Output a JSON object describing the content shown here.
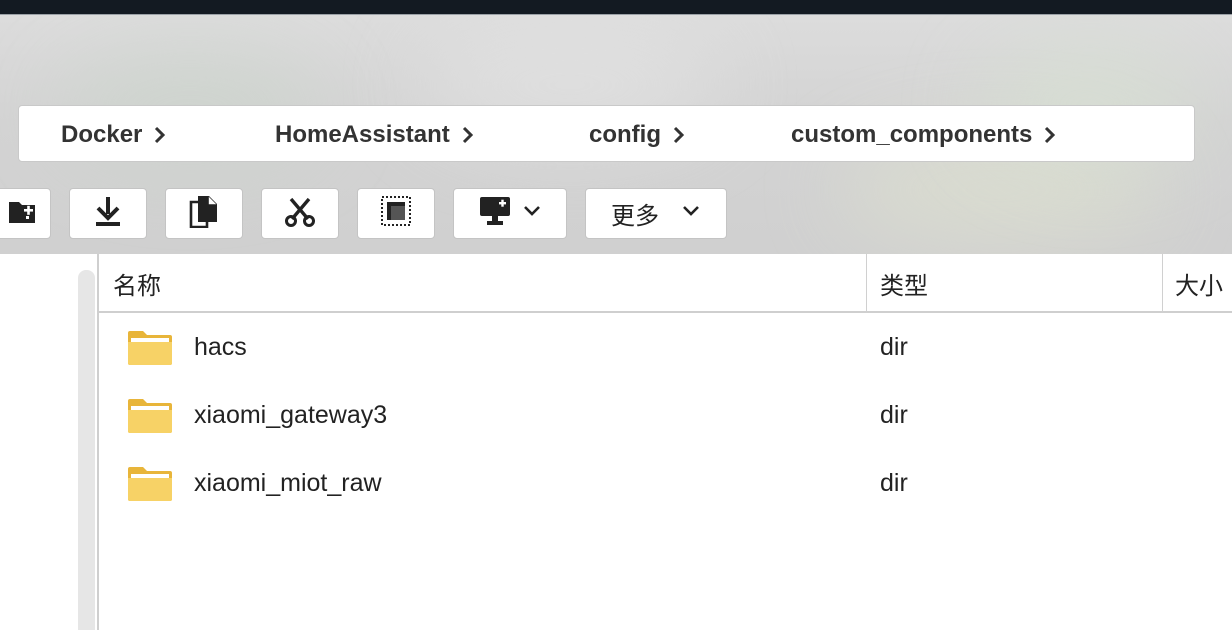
{
  "breadcrumb": {
    "items": [
      {
        "label": "Docker"
      },
      {
        "label": "HomeAssistant"
      },
      {
        "label": "config"
      },
      {
        "label": "custom_components"
      }
    ]
  },
  "toolbar": {
    "buttons": [
      {
        "icon": "create-folder-icon"
      },
      {
        "icon": "download-icon"
      },
      {
        "icon": "copy-icon"
      },
      {
        "icon": "cut-icon"
      },
      {
        "icon": "select-all-icon"
      },
      {
        "icon": "remote-connect-icon",
        "has_dropdown": true
      },
      {
        "label": "更多",
        "has_dropdown": true
      }
    ]
  },
  "file_list": {
    "columns": [
      "名称",
      "类型",
      "大小"
    ],
    "rows": [
      {
        "name": "hacs",
        "type": "dir",
        "icon": "folder-icon"
      },
      {
        "name": "xiaomi_gateway3",
        "type": "dir",
        "icon": "folder-icon"
      },
      {
        "name": "xiaomi_miot_raw",
        "type": "dir",
        "icon": "folder-icon"
      }
    ]
  },
  "colors": {
    "folder_yellow": "#f5c84c",
    "header_gray": "#d3d3d3",
    "top_bar": "#131a22"
  }
}
